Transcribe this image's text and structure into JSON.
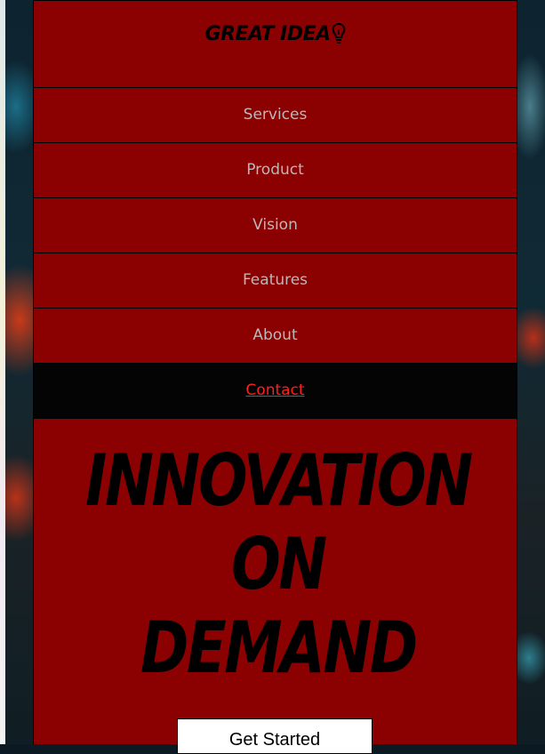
{
  "brand": {
    "logo_text": "GREAT IDEA",
    "icon": "lightbulb-icon"
  },
  "nav": {
    "items": [
      {
        "label": "Services"
      },
      {
        "label": "Product"
      },
      {
        "label": "Vision"
      },
      {
        "label": "Features"
      },
      {
        "label": "About"
      },
      {
        "label": "Contact",
        "active": true
      }
    ]
  },
  "hero": {
    "line1": "INNOVATION",
    "line2": "ON",
    "line3": "DEMAND",
    "cta_label": "Get Started"
  },
  "colors": {
    "panel": "#8b0000",
    "nav_text": "#b9b9b9",
    "active_bg": "#040404",
    "active_text": "#ff1f1f"
  }
}
